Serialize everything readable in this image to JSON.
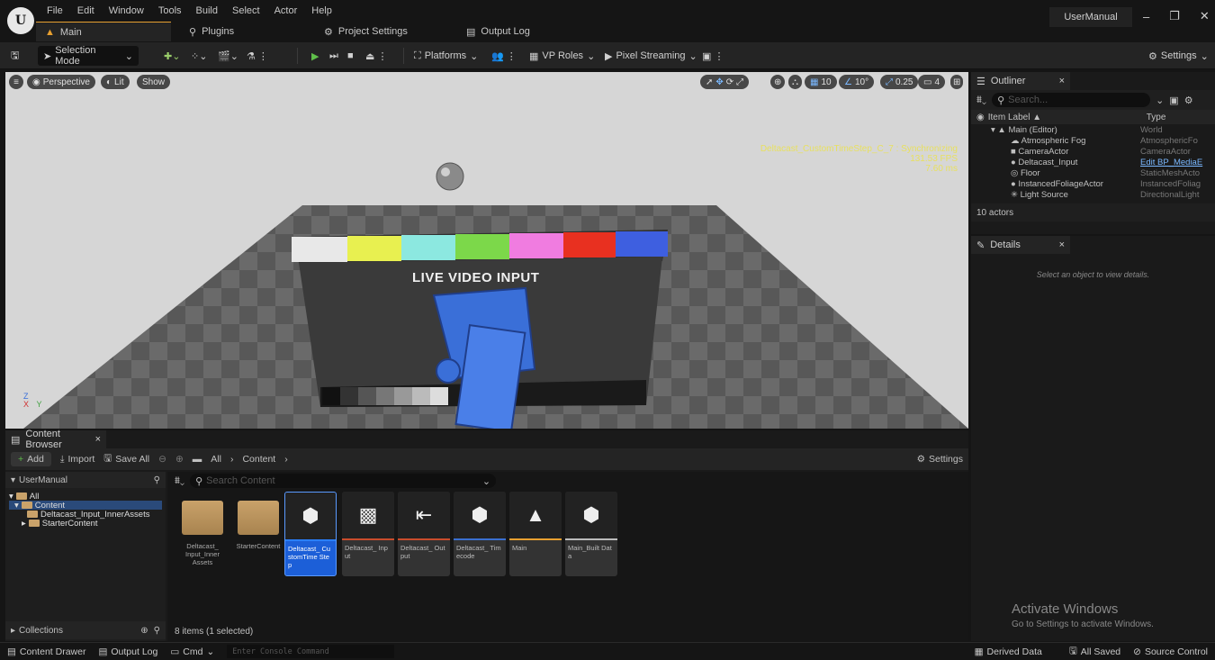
{
  "menu": [
    "File",
    "Edit",
    "Window",
    "Tools",
    "Build",
    "Select",
    "Actor",
    "Help"
  ],
  "tabs": {
    "main": "Main",
    "plugins": "Plugins",
    "project_settings": "Project Settings",
    "output_log": "Output Log"
  },
  "project_name": "UserManual",
  "toolbar": {
    "selection_mode": "Selection Mode",
    "platforms": "Platforms",
    "vp_roles": "VP Roles",
    "pixel_streaming": "Pixel Streaming",
    "settings": "Settings"
  },
  "viewport": {
    "perspective": "Perspective",
    "lit": "Lit",
    "show": "Show",
    "grid": "10",
    "angle": "10°",
    "scale": "0.25",
    "cam_speed": "4",
    "stats": {
      "timestep": "Deltacast_CustomTimeStep_C_7 : Synchronizing",
      "fps": "131.53 FPS",
      "ms": "7.60 ms"
    },
    "screen_text": "LIVE VIDEO INPUT",
    "axis_z": "Z",
    "axis_y": "Y",
    "axis_x": "X"
  },
  "outliner": {
    "tab": "Outliner",
    "search_placeholder": "Search...",
    "col_label": "Item Label ▲",
    "col_type": "Type",
    "rows": [
      {
        "label": "Main (Editor)",
        "type": "World"
      },
      {
        "label": "Atmospheric Fog",
        "type": "AtmosphericFo"
      },
      {
        "label": "CameraActor",
        "type": "CameraActor"
      },
      {
        "label": "Deltacast_Input",
        "type": "Edit BP_MediaE"
      },
      {
        "label": "Floor",
        "type": "StaticMeshActo"
      },
      {
        "label": "InstancedFoliageActor",
        "type": "InstancedFoliag"
      },
      {
        "label": "Light Source",
        "type": "DirectionalLight"
      }
    ],
    "count": "10 actors"
  },
  "details": {
    "tab": "Details",
    "empty": "Select an object to view details."
  },
  "content_browser": {
    "tab": "Content Browser",
    "add": "Add",
    "import": "Import",
    "save_all": "Save All",
    "path_all": "All",
    "path_content": "Content",
    "settings": "Settings",
    "root": "UserManual",
    "search_placeholder": "Search Content",
    "tree": [
      "All",
      "Content",
      "Deltacast_Input_InnerAssets",
      "StarterContent"
    ],
    "collections": "Collections",
    "status": "8 items (1 selected)",
    "assets": [
      {
        "label": "Deltacast_ Input_Inner Assets",
        "kind": "folder"
      },
      {
        "label": "StarterContent",
        "kind": "folder"
      },
      {
        "label": "Deltacast_ CustomTime Step",
        "kind": "asset",
        "color": "#2a7fff",
        "selected": true
      },
      {
        "label": "Deltacast_ Input",
        "kind": "asset",
        "color": "#c94c2c"
      },
      {
        "label": "Deltacast_ Output",
        "kind": "asset",
        "color": "#c94c2c"
      },
      {
        "label": "Deltacast_ Timecode",
        "kind": "asset",
        "color": "#3a6fd0"
      },
      {
        "label": "Main",
        "kind": "asset",
        "color": "#e8a030"
      },
      {
        "label": "Main_Built Data",
        "kind": "asset",
        "color": "#bbbbbb"
      }
    ]
  },
  "statusbar": {
    "content_drawer": "Content Drawer",
    "output_log": "Output Log",
    "cmd": "Cmd",
    "console_placeholder": "Enter Console Command",
    "derived_data": "Derived Data",
    "all_saved": "All Saved",
    "source_control": "Source Control"
  },
  "watermark": {
    "line1": "Activate Windows",
    "line2": "Go to Settings to activate Windows."
  }
}
